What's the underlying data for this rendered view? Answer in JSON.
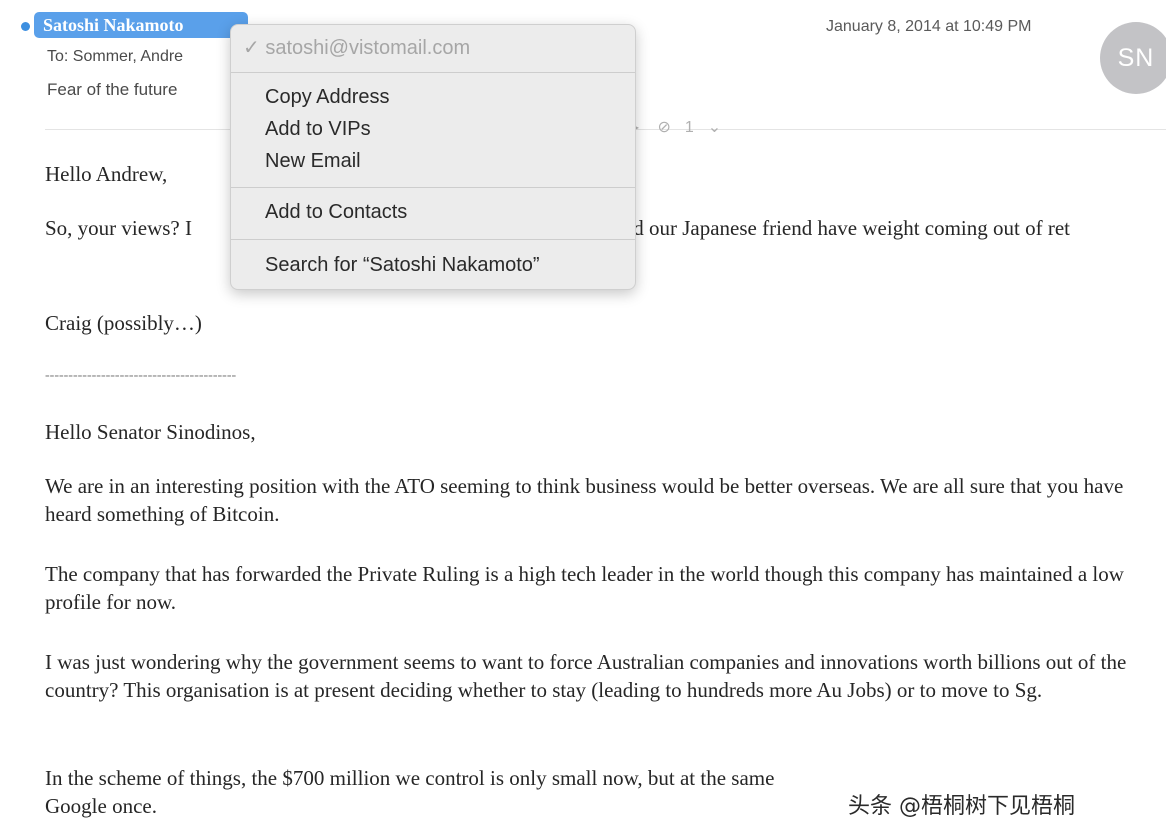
{
  "header": {
    "sender": "Satoshi Nakamoto",
    "to": "To: Sommer, Andre",
    "subject": "Fear of the future",
    "date": "January 8, 2014 at 10:49 PM",
    "avatar_initials": "SN",
    "attachment_count": "1",
    "accent": "#5aa0ea"
  },
  "context_menu": {
    "email": "✓ satoshi@vistomail.com",
    "items": [
      "Copy Address",
      "Add to VIPs",
      "New Email",
      "Add to Contacts",
      "Search for “Satoshi Nakamoto”"
    ]
  },
  "body": {
    "greeting": "Hello Andrew,",
    "para1": "So, your views? I                                                                   ved? Would our Japanese friend have weight coming out of ret",
    "sign": "Craig (possibly…)",
    "rule": "-----------------------------------------",
    "greeting2": "Hello Senator Sinodinos,",
    "para2": "We are in an interesting position with the ATO seeming to think business would be better overseas. We are all sure that you have heard something of Bitcoin.",
    "para3": "The company that has forwarded the Private Ruling is a high tech leader in the world though this company has maintained a low profile for now.",
    "para4": "I was just wondering why the government seems to want to force Australian companies and innovations worth billions out of the country? This organisation is at present deciding whether to stay (leading to hundreds more Au Jobs) or to move to Sg.",
    "para5": "In the scheme of things, the $700 million we control is only small now, but at the same",
    "para5b": "Google once."
  },
  "watermark": "头条 @梧桐树下见梧桐"
}
